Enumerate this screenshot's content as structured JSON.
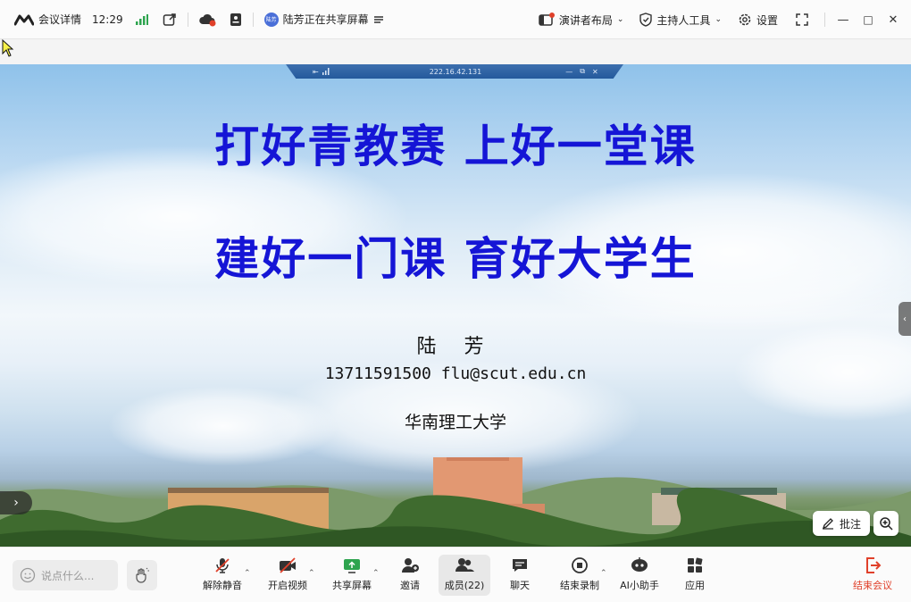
{
  "header": {
    "meeting_details": "会议详情",
    "time": "12:29",
    "sharing_status": "陆芳正在共享屏幕",
    "sharing_avatar": "陆芳",
    "speaker_layout": "演讲者布局",
    "host_tools": "主持人工具",
    "settings": "设置"
  },
  "remote_bar": {
    "ip": "222.16.42.131"
  },
  "slide": {
    "title_line1": "打好青教赛  上好一堂课",
    "title_line2": "建好一门课  育好大学生",
    "author": "陆 芳",
    "contact": "13711591500  flu@scut.edu.cn",
    "school": "华南理工大学"
  },
  "overlay": {
    "annotate": "批注"
  },
  "toolbar": {
    "chat_placeholder": "说点什么...",
    "unmute": "解除静音",
    "start_video": "开启视频",
    "share_screen": "共享屏幕",
    "invite": "邀请",
    "members": "成员(22)",
    "chat": "聊天",
    "stop_recording": "结束录制",
    "ai_assistant": "AI小助手",
    "apps": "应用",
    "end_meeting": "结束会议"
  },
  "colors": {
    "title_blue": "#1515d6",
    "end_red": "#e0402a",
    "signal_green": "#2ea44f"
  }
}
